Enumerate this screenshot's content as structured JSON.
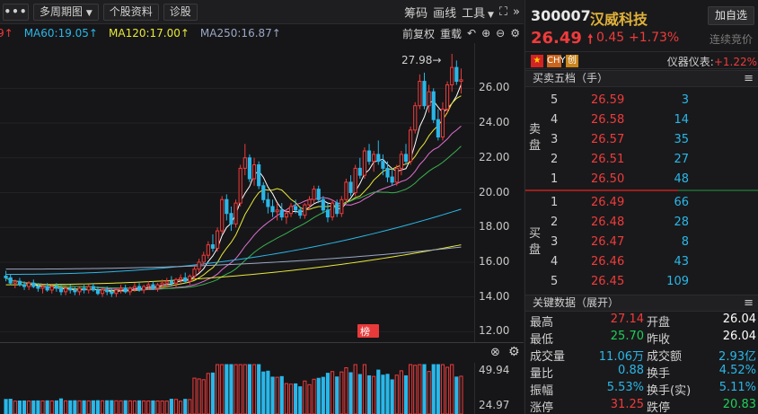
{
  "toolbar": {
    "more": "•••",
    "period": "多周期图",
    "profile": "个股资料",
    "diagnose": "诊股",
    "chips": "筹码",
    "draw": "画线",
    "tools": "工具",
    "expand": "⛶",
    "collapse": "»"
  },
  "ma_row": {
    "ma_partial": "9↑",
    "ma60": "MA60:19.05↑",
    "ma120": "MA120:17.00↑",
    "ma250": "MA250:16.87↑",
    "adjust": "前复权",
    "overlay": "重载"
  },
  "colors": {
    "up": "#f03b3b",
    "down": "#2ab7e8",
    "ma60": "#2ab7e8",
    "ma120": "#e8e83a",
    "ma250": "#9aa7c4"
  },
  "chart": {
    "high_label": "27.98→",
    "badge": "龙虎榜",
    "badge_short": "榜",
    "price_ticks": [
      "26.00",
      "24.00",
      "22.00",
      "20.00",
      "18.00",
      "16.00",
      "14.00",
      "12.00"
    ],
    "sub_ticks": [
      "49.94",
      "24.97"
    ]
  },
  "chart_data": {
    "type": "candlestick",
    "y_ticks": [
      12,
      14,
      16,
      18,
      20,
      22,
      24,
      26
    ],
    "ylim": [
      11.4,
      28.6
    ],
    "period_high": 27.98,
    "ohlc": [
      [
        15.2,
        15.5,
        14.9,
        15.1
      ],
      [
        15.1,
        15.3,
        14.7,
        14.8
      ],
      [
        14.8,
        15.0,
        14.5,
        14.9
      ],
      [
        14.9,
        15.1,
        14.6,
        14.7
      ],
      [
        14.7,
        14.9,
        14.4,
        14.6
      ],
      [
        14.6,
        14.9,
        14.4,
        14.8
      ],
      [
        14.8,
        15.0,
        14.5,
        14.6
      ],
      [
        14.6,
        14.8,
        14.3,
        14.5
      ],
      [
        14.5,
        14.7,
        14.2,
        14.6
      ],
      [
        14.6,
        14.8,
        14.3,
        14.4
      ],
      [
        14.4,
        14.7,
        14.2,
        14.6
      ],
      [
        14.6,
        14.8,
        14.3,
        14.5
      ],
      [
        14.5,
        14.7,
        14.1,
        14.3
      ],
      [
        14.3,
        14.6,
        14.1,
        14.5
      ],
      [
        14.5,
        14.7,
        14.2,
        14.4
      ],
      [
        14.4,
        14.6,
        14.1,
        14.3
      ],
      [
        14.3,
        14.6,
        14.1,
        14.5
      ],
      [
        14.5,
        14.7,
        14.2,
        14.4
      ],
      [
        14.4,
        14.7,
        14.2,
        14.6
      ],
      [
        14.6,
        14.8,
        14.3,
        14.4
      ],
      [
        14.4,
        14.6,
        14.1,
        14.2
      ],
      [
        14.2,
        14.5,
        14.0,
        14.4
      ],
      [
        14.4,
        14.6,
        14.1,
        14.3
      ],
      [
        14.3,
        14.5,
        14.0,
        14.2
      ],
      [
        14.2,
        14.5,
        14.0,
        14.4
      ],
      [
        14.4,
        14.7,
        14.2,
        14.5
      ],
      [
        14.5,
        14.7,
        14.2,
        14.3
      ],
      [
        14.3,
        14.6,
        14.1,
        14.5
      ],
      [
        14.5,
        14.8,
        14.3,
        14.6
      ],
      [
        14.6,
        14.8,
        14.3,
        14.4
      ],
      [
        14.4,
        14.7,
        14.2,
        14.6
      ],
      [
        14.6,
        14.9,
        14.4,
        14.7
      ],
      [
        14.7,
        14.9,
        14.4,
        14.5
      ],
      [
        14.5,
        14.8,
        14.3,
        14.7
      ],
      [
        14.7,
        15.0,
        14.5,
        14.8
      ],
      [
        14.8,
        15.1,
        14.6,
        14.9
      ],
      [
        14.9,
        15.2,
        14.6,
        14.8
      ],
      [
        14.8,
        15.1,
        14.5,
        15.0
      ],
      [
        15.0,
        15.3,
        14.8,
        15.1
      ],
      [
        15.1,
        15.4,
        14.8,
        14.9
      ],
      [
        14.9,
        15.3,
        14.7,
        15.2
      ],
      [
        15.2,
        15.8,
        15.0,
        15.6
      ],
      [
        15.6,
        16.2,
        15.4,
        16.0
      ],
      [
        16.0,
        16.6,
        15.8,
        16.4
      ],
      [
        16.4,
        17.2,
        16.2,
        17.0
      ],
      [
        17.0,
        17.6,
        16.6,
        16.8
      ],
      [
        16.8,
        18.0,
        16.6,
        17.8
      ],
      [
        17.8,
        19.8,
        17.6,
        19.6
      ],
      [
        19.6,
        19.9,
        18.4,
        18.8
      ],
      [
        18.8,
        19.2,
        17.8,
        18.2
      ],
      [
        18.2,
        19.6,
        18.0,
        19.4
      ],
      [
        19.4,
        21.6,
        19.2,
        21.4
      ],
      [
        21.4,
        22.8,
        21.0,
        22.0
      ],
      [
        22.0,
        22.2,
        20.6,
        20.8
      ],
      [
        20.8,
        22.0,
        20.4,
        21.6
      ],
      [
        21.6,
        21.8,
        20.2,
        20.4
      ],
      [
        20.4,
        20.6,
        19.4,
        19.6
      ],
      [
        19.6,
        20.0,
        18.8,
        19.2
      ],
      [
        19.2,
        19.6,
        18.6,
        18.9
      ],
      [
        18.9,
        19.4,
        18.4,
        19.0
      ],
      [
        19.0,
        19.4,
        18.4,
        18.6
      ],
      [
        18.6,
        19.0,
        18.2,
        18.8
      ],
      [
        18.8,
        19.4,
        18.6,
        19.2
      ],
      [
        19.2,
        19.6,
        18.8,
        19.0
      ],
      [
        19.0,
        19.2,
        18.5,
        18.7
      ],
      [
        18.7,
        19.4,
        18.5,
        19.3
      ],
      [
        19.3,
        19.8,
        19.0,
        19.6
      ],
      [
        19.6,
        20.4,
        19.4,
        20.2
      ],
      [
        20.2,
        20.4,
        19.4,
        19.6
      ],
      [
        19.6,
        19.8,
        18.8,
        19.0
      ],
      [
        19.0,
        19.4,
        18.3,
        18.6
      ],
      [
        18.6,
        19.6,
        18.4,
        19.4
      ],
      [
        19.4,
        19.6,
        18.6,
        18.8
      ],
      [
        18.8,
        19.8,
        18.6,
        19.6
      ],
      [
        19.6,
        20.8,
        19.4,
        20.6
      ],
      [
        20.6,
        21.0,
        19.8,
        20.0
      ],
      [
        20.0,
        21.6,
        19.8,
        21.4
      ],
      [
        21.4,
        22.0,
        20.8,
        21.0
      ],
      [
        21.0,
        22.6,
        20.8,
        22.4
      ],
      [
        22.4,
        22.8,
        21.6,
        21.8
      ],
      [
        21.8,
        22.4,
        21.2,
        22.2
      ],
      [
        22.2,
        23.0,
        21.6,
        21.8
      ],
      [
        21.8,
        22.2,
        21.0,
        21.4
      ],
      [
        21.4,
        21.8,
        20.6,
        20.9
      ],
      [
        20.9,
        21.4,
        20.4,
        20.6
      ],
      [
        20.6,
        21.6,
        20.4,
        21.4
      ],
      [
        21.4,
        22.4,
        21.0,
        22.2
      ],
      [
        22.2,
        22.8,
        21.6,
        21.8
      ],
      [
        21.8,
        23.8,
        21.6,
        23.6
      ],
      [
        23.6,
        25.2,
        23.4,
        25.0
      ],
      [
        25.0,
        26.8,
        24.8,
        26.4
      ],
      [
        26.4,
        26.9,
        24.8,
        25.0
      ],
      [
        25.0,
        26.2,
        24.6,
        25.8
      ],
      [
        25.8,
        26.0,
        24.0,
        24.2
      ],
      [
        24.2,
        24.8,
        23.0,
        23.2
      ],
      [
        23.2,
        25.2,
        23.0,
        24.8
      ],
      [
        24.8,
        26.4,
        24.6,
        26.2
      ],
      [
        26.2,
        27.98,
        25.8,
        27.2
      ],
      [
        27.2,
        27.6,
        26.2,
        26.4
      ],
      [
        26.4,
        27.14,
        25.7,
        26.49
      ]
    ]
  },
  "stock": {
    "code": "300007",
    "name": "汉威科技",
    "add_label": "加自选",
    "price": "26.49",
    "arrow": "🠕",
    "change": "0.45",
    "change_pct": "+1.73%",
    "auction": "连续竞价",
    "tag_chy": "CHY",
    "tag_chuang": "创",
    "index_label": "仪器仪表:",
    "index_pct": "+1.22%"
  },
  "orderbook": {
    "title": "买卖五档（手）",
    "menu": "≡",
    "sell_label": [
      "卖",
      "盘"
    ],
    "buy_label": [
      "买",
      "盘"
    ],
    "asks": [
      {
        "level": "5",
        "price": "26.59",
        "vol": "3"
      },
      {
        "level": "4",
        "price": "26.58",
        "vol": "14"
      },
      {
        "level": "3",
        "price": "26.57",
        "vol": "35"
      },
      {
        "level": "2",
        "price": "26.51",
        "vol": "27"
      },
      {
        "level": "1",
        "price": "26.50",
        "vol": "48"
      }
    ],
    "bids": [
      {
        "level": "1",
        "price": "26.49",
        "vol": "66"
      },
      {
        "level": "2",
        "price": "26.48",
        "vol": "28"
      },
      {
        "level": "3",
        "price": "26.47",
        "vol": "8"
      },
      {
        "level": "4",
        "price": "26.46",
        "vol": "43"
      },
      {
        "level": "5",
        "price": "26.45",
        "vol": "109"
      }
    ]
  },
  "keydata": {
    "title": "关键数据（展开）",
    "menu": "≡",
    "rows": [
      {
        "l1": "最高",
        "v1": "27.14",
        "c1": "red",
        "l2": "开盘",
        "v2": "26.04",
        "c2": "white"
      },
      {
        "l1": "最低",
        "v1": "25.70",
        "c1": "green",
        "l2": "昨收",
        "v2": "26.04",
        "c2": "white"
      },
      {
        "l1": "成交量",
        "v1": "11.06万",
        "c1": "cyan",
        "l2": "成交额",
        "v2": "2.93亿",
        "c2": "cyan"
      },
      {
        "l1": "量比",
        "v1": "0.88",
        "c1": "cyan",
        "l2": "换手",
        "v2": "4.52%",
        "c2": "cyan"
      },
      {
        "l1": "振幅",
        "v1": "5.53%",
        "c1": "cyan",
        "l2": "换手(实)",
        "v2": "5.11%",
        "c2": "cyan"
      },
      {
        "l1": "涨停",
        "v1": "31.25",
        "c1": "red",
        "l2": "跌停",
        "v2": "20.83",
        "c2": "green"
      }
    ]
  }
}
